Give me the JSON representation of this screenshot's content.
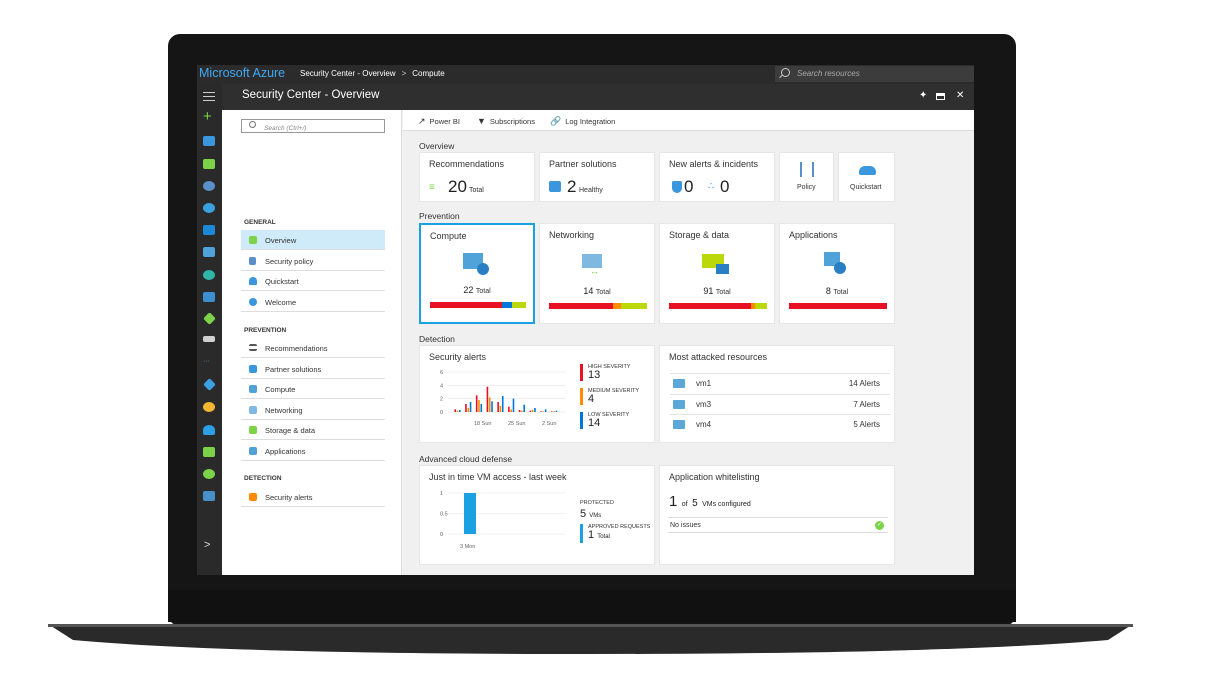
{
  "topbar": {
    "brand": "Microsoft Azure",
    "breadcrumb": [
      "Security Center - Overview",
      "Compute"
    ],
    "breadcrumb_sep": ">",
    "search_placeholder": "Search resources"
  },
  "blade": {
    "title": "Security Center - Overview",
    "pin_icon": "pin-icon",
    "maximize_icon": "maximize-icon",
    "close_icon": "close-icon"
  },
  "menu": {
    "search_placeholder": "Search (Ctrl+/)",
    "sections": [
      {
        "heading": "GENERAL",
        "items": [
          {
            "label": "Overview",
            "icon": "shield-icon",
            "active": true
          },
          {
            "label": "Security policy",
            "icon": "policy-icon"
          },
          {
            "label": "Quickstart",
            "icon": "cloud-icon"
          },
          {
            "label": "Welcome",
            "icon": "welcome-icon"
          }
        ]
      },
      {
        "heading": "PREVENTION",
        "items": [
          {
            "label": "Recommendations",
            "icon": "list-icon"
          },
          {
            "label": "Partner solutions",
            "icon": "partner-icon"
          },
          {
            "label": "Compute",
            "icon": "compute-icon"
          },
          {
            "label": "Networking",
            "icon": "network-icon"
          },
          {
            "label": "Storage & data",
            "icon": "storage-icon"
          },
          {
            "label": "Applications",
            "icon": "apps-icon"
          }
        ]
      },
      {
        "heading": "DETECTION",
        "items": [
          {
            "label": "Security alerts",
            "icon": "alert-icon"
          }
        ]
      }
    ]
  },
  "toolbar": {
    "power_bi": "Power BI",
    "subscriptions": "Subscriptions",
    "log_integration": "Log Integration"
  },
  "overview": {
    "heading": "Overview",
    "recommendations": {
      "title": "Recommendations",
      "value": "20",
      "unit": "Total"
    },
    "partner": {
      "title": "Partner solutions",
      "value": "2",
      "unit": "Healthy"
    },
    "alerts": {
      "title": "New alerts & incidents",
      "alerts_value": "0",
      "incidents_value": "0"
    },
    "policy": {
      "label": "Policy"
    },
    "quickstart": {
      "label": "Quickstart"
    }
  },
  "prevention": {
    "heading": "Prevention",
    "tiles": [
      {
        "title": "Compute",
        "value": "22",
        "unit": "Total",
        "bar": [
          {
            "p": 0.75,
            "c": "#e81123"
          },
          {
            "p": 0.1,
            "c": "#0078d7"
          },
          {
            "p": 0.15,
            "c": "#bad80a"
          }
        ]
      },
      {
        "title": "Networking",
        "value": "14",
        "unit": "Total",
        "bar": [
          {
            "p": 0.65,
            "c": "#e81123"
          },
          {
            "p": 0.08,
            "c": "#ff8c00"
          },
          {
            "p": 0.27,
            "c": "#bad80a"
          }
        ]
      },
      {
        "title": "Storage & data",
        "value": "91",
        "unit": "Total",
        "bar": [
          {
            "p": 0.84,
            "c": "#e81123"
          },
          {
            "p": 0.04,
            "c": "#ff8c00"
          },
          {
            "p": 0.12,
            "c": "#bad80a"
          }
        ]
      },
      {
        "title": "Applications",
        "value": "8",
        "unit": "Total",
        "bar": [
          {
            "p": 1.0,
            "c": "#e81123"
          }
        ]
      }
    ]
  },
  "detection": {
    "heading": "Detection",
    "security_alerts": {
      "title": "Security alerts",
      "high": {
        "label": "HIGH SEVERITY",
        "value": "13"
      },
      "medium": {
        "label": "MEDIUM SEVERITY",
        "value": "4"
      },
      "low": {
        "label": "LOW SEVERITY",
        "value": "14"
      }
    },
    "most_attacked": {
      "title": "Most attacked resources",
      "rows": [
        {
          "name": "vm1",
          "value": "14 Alerts"
        },
        {
          "name": "vm3",
          "value": "7 Alerts"
        },
        {
          "name": "vm4",
          "value": "5 Alerts"
        }
      ]
    }
  },
  "advanced": {
    "heading": "Advanced cloud defense",
    "jit": {
      "title": "Just in time VM access - last week",
      "protected_label": "PROTECTED",
      "protected_value": "5",
      "protected_unit": "VMs",
      "approved_label": "APPROVED REQUESTS",
      "approved_value": "1",
      "approved_unit": "Total"
    },
    "whitelist": {
      "title": "Application whitelisting",
      "count": "1",
      "of_text": "of",
      "total": "5",
      "suffix": "VMs configured",
      "status": "No issues"
    }
  },
  "chart_data": [
    {
      "type": "bar",
      "title": "Security alerts",
      "x_ticks": [
        "18 Sun",
        "25 Sun",
        "2 Sun"
      ],
      "ylim": [
        0,
        6
      ],
      "y_ticks": [
        "6",
        "4",
        "2",
        "0"
      ],
      "series": [
        {
          "values": [
            0.4,
            1.2,
            2.5,
            3.8,
            1.5,
            0.8,
            0.3,
            0.2,
            0.1,
            0.1
          ],
          "color": "#e81123"
        },
        {
          "values": [
            0.2,
            0.6,
            1.8,
            2.2,
            0.9,
            0.4,
            0.2,
            0.3,
            0.1,
            0.1
          ],
          "color": "#ff8c00"
        },
        {
          "values": [
            0.3,
            1.5,
            1.2,
            1.6,
            2.4,
            2.0,
            1.1,
            0.6,
            0.4,
            0.2
          ],
          "color": "#0078d7"
        }
      ]
    },
    {
      "type": "bar",
      "title": "Just in time VM access - last week",
      "x_ticks": [
        "3 Mon"
      ],
      "ylim": [
        0,
        1
      ],
      "y_ticks": [
        "1",
        "0.5",
        "0"
      ],
      "values": [
        1
      ]
    }
  ]
}
